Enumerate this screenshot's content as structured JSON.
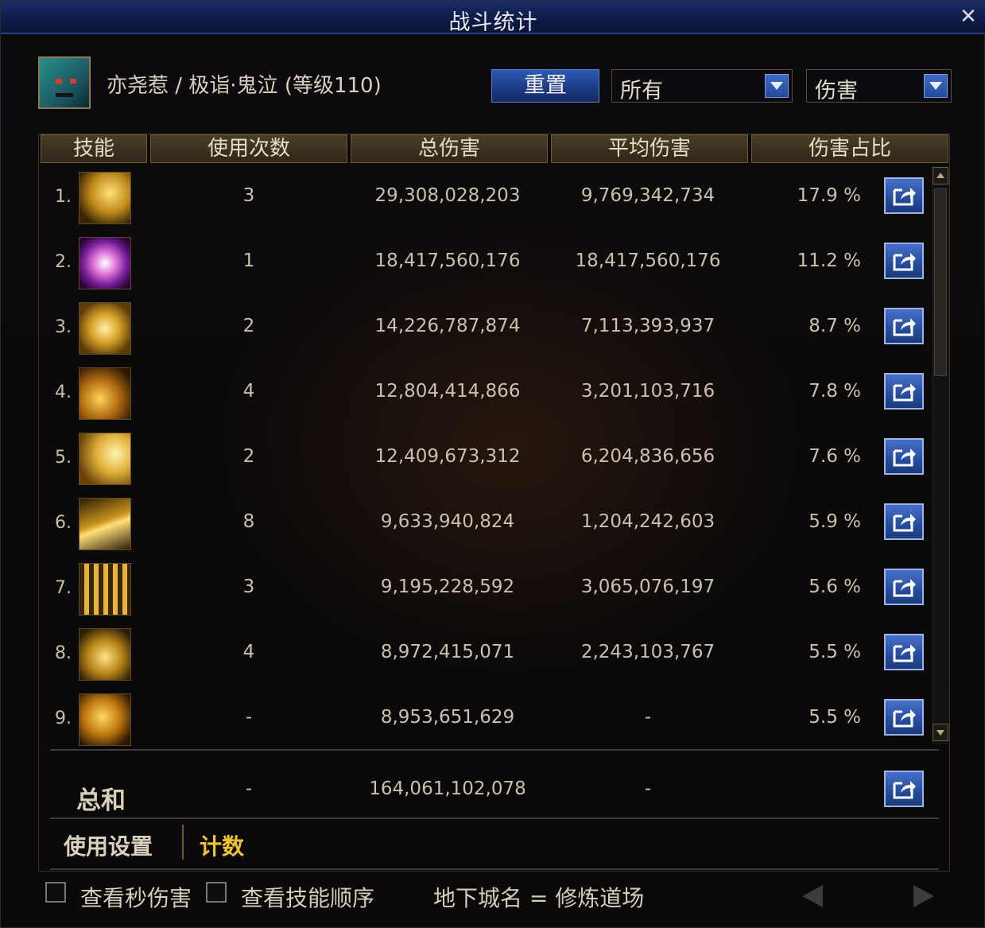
{
  "window": {
    "title": "战斗统计",
    "close_label": "✕"
  },
  "character": {
    "name": "亦尧惹 / 极诣·鬼泣 (等级110)"
  },
  "controls": {
    "reset_label": "重置",
    "filter_value": "所有",
    "metric_value": "伤害"
  },
  "columns": [
    "技能",
    "使用次数",
    "总伤害",
    "平均伤害",
    "伤害占比"
  ],
  "rows": [
    {
      "rank": "1.",
      "uses": "3",
      "total": "29,308,028,203",
      "avg": "9,769,342,734",
      "pct": "17.9 %"
    },
    {
      "rank": "2.",
      "uses": "1",
      "total": "18,417,560,176",
      "avg": "18,417,560,176",
      "pct": "11.2 %"
    },
    {
      "rank": "3.",
      "uses": "2",
      "total": "14,226,787,874",
      "avg": "7,113,393,937",
      "pct": "8.7 %"
    },
    {
      "rank": "4.",
      "uses": "4",
      "total": "12,804,414,866",
      "avg": "3,201,103,716",
      "pct": "7.8 %"
    },
    {
      "rank": "5.",
      "uses": "2",
      "total": "12,409,673,312",
      "avg": "6,204,836,656",
      "pct": "7.6 %"
    },
    {
      "rank": "6.",
      "uses": "8",
      "total": "9,633,940,824",
      "avg": "1,204,242,603",
      "pct": "5.9 %"
    },
    {
      "rank": "7.",
      "uses": "3",
      "total": "9,195,228,592",
      "avg": "3,065,076,197",
      "pct": "5.6 %"
    },
    {
      "rank": "8.",
      "uses": "4",
      "total": "8,972,415,071",
      "avg": "2,243,103,767",
      "pct": "5.5 %"
    },
    {
      "rank": "9.",
      "uses": "-",
      "total": "8,953,651,629",
      "avg": "-",
      "pct": "5.5 %"
    }
  ],
  "totals": {
    "label": "总和",
    "uses": "-",
    "total": "164,061,102,078",
    "avg": "-"
  },
  "tabs": {
    "settings": "使用设置",
    "count": "计数"
  },
  "footer": {
    "check_dps": "查看秒伤害",
    "check_order": "查看技能顺序",
    "dungeon": "地下城名 = 修炼道场"
  },
  "colors": {
    "accent_gold": "#f2c233",
    "button_blue": "#2c5ab4",
    "title_blue": "#1a2c6a"
  },
  "icons": [
    "close-icon",
    "dropdown-arrow-icon",
    "share-icon",
    "scroll-up-icon",
    "scroll-down-icon",
    "prev-page-icon",
    "next-page-icon"
  ]
}
